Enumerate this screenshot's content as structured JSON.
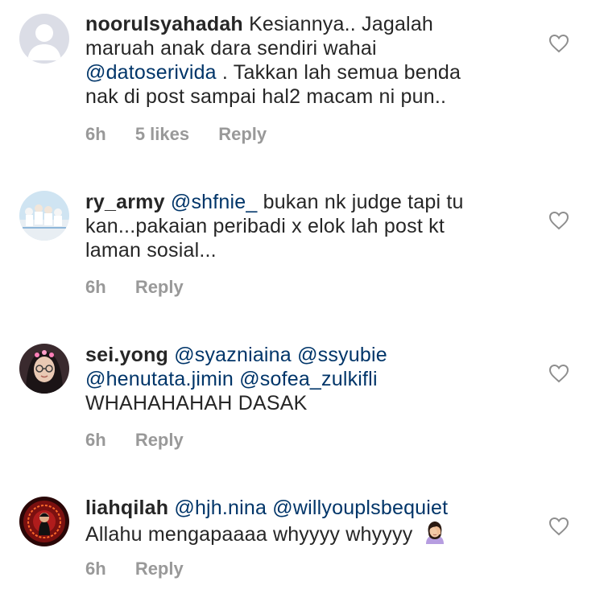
{
  "colors": {
    "text": "#262626",
    "mention": "#003569",
    "meta": "#999999",
    "heart_outline": "#8e8e8e"
  },
  "comments": [
    {
      "username": "noorulsyahadah",
      "text_parts": [
        {
          "type": "text",
          "value": "Kesiannya.. Jagalah maruah anak dara sendiri wahai "
        },
        {
          "type": "mention",
          "value": "@datoserivida"
        },
        {
          "type": "text",
          "value": " . Takkan lah semua benda nak di post sampai hal2 macam ni pun.."
        }
      ],
      "time": "6h",
      "likes": "5 likes",
      "reply": "Reply",
      "avatar": "default-avatar-icon"
    },
    {
      "username": "ry_army",
      "text_parts": [
        {
          "type": "mention",
          "value": "@shfnie_"
        },
        {
          "type": "text",
          "value": " bukan nk judge tapi tu kan...pakaian peribadi x elok lah post kt laman sosial..."
        }
      ],
      "time": "6h",
      "reply": "Reply",
      "avatar": "group-photo-avatar"
    },
    {
      "username": "sei.yong",
      "text_parts": [
        {
          "type": "mention",
          "value": "@syazniaina"
        },
        {
          "type": "text",
          "value": " "
        },
        {
          "type": "mention",
          "value": "@ssyubie"
        },
        {
          "type": "text",
          "value": " "
        },
        {
          "type": "mention",
          "value": "@henutata.jimin"
        },
        {
          "type": "text",
          "value": " "
        },
        {
          "type": "mention",
          "value": "@sofea_zulkifli"
        },
        {
          "type": "text",
          "value": " WHAHAHAHAH DASAK"
        }
      ],
      "time": "6h",
      "reply": "Reply",
      "avatar": "selfie-avatar"
    },
    {
      "username": "liahqilah",
      "text_parts": [
        {
          "type": "mention",
          "value": "@hjh.nina"
        },
        {
          "type": "text",
          "value": " "
        },
        {
          "type": "mention",
          "value": "@willyouplsbequiet"
        },
        {
          "type": "text",
          "value": " Allahu mengapaaaa whyyyy whyyyy "
        }
      ],
      "emoji": "facepalm-woman-emoji",
      "time": "6h",
      "reply": "Reply",
      "avatar": "red-circle-avatar"
    }
  ]
}
